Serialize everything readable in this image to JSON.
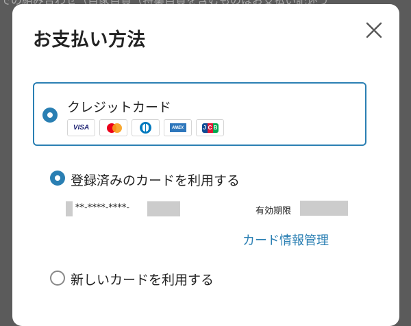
{
  "background": {
    "text": "での組み合わせ（自家自費（特集自費を含むものはお支払い記述う"
  },
  "modal": {
    "title": "お支払い方法",
    "close_icon": "close-icon"
  },
  "payment": {
    "credit_card": {
      "label": "クレジットカード",
      "selected": true,
      "brands": [
        "VISA",
        "Mastercard",
        "Diners Club",
        "AMEX",
        "JCB"
      ],
      "visa_text": "VISA",
      "amex_text": "AMEX",
      "jcb_letters": [
        "J",
        "C",
        "B"
      ]
    },
    "registered": {
      "label": "登録済みのカードを利用する",
      "selected": true,
      "masked_number": "**-****-****-",
      "expiry_label": "有効期限",
      "manage_link": "カード情報管理"
    },
    "new_card": {
      "label": "新しいカードを利用する",
      "selected": false
    }
  },
  "colors": {
    "accent": "#2a7fb3",
    "overlay": "#5b5b5b",
    "masked_block": "#cccccc"
  }
}
